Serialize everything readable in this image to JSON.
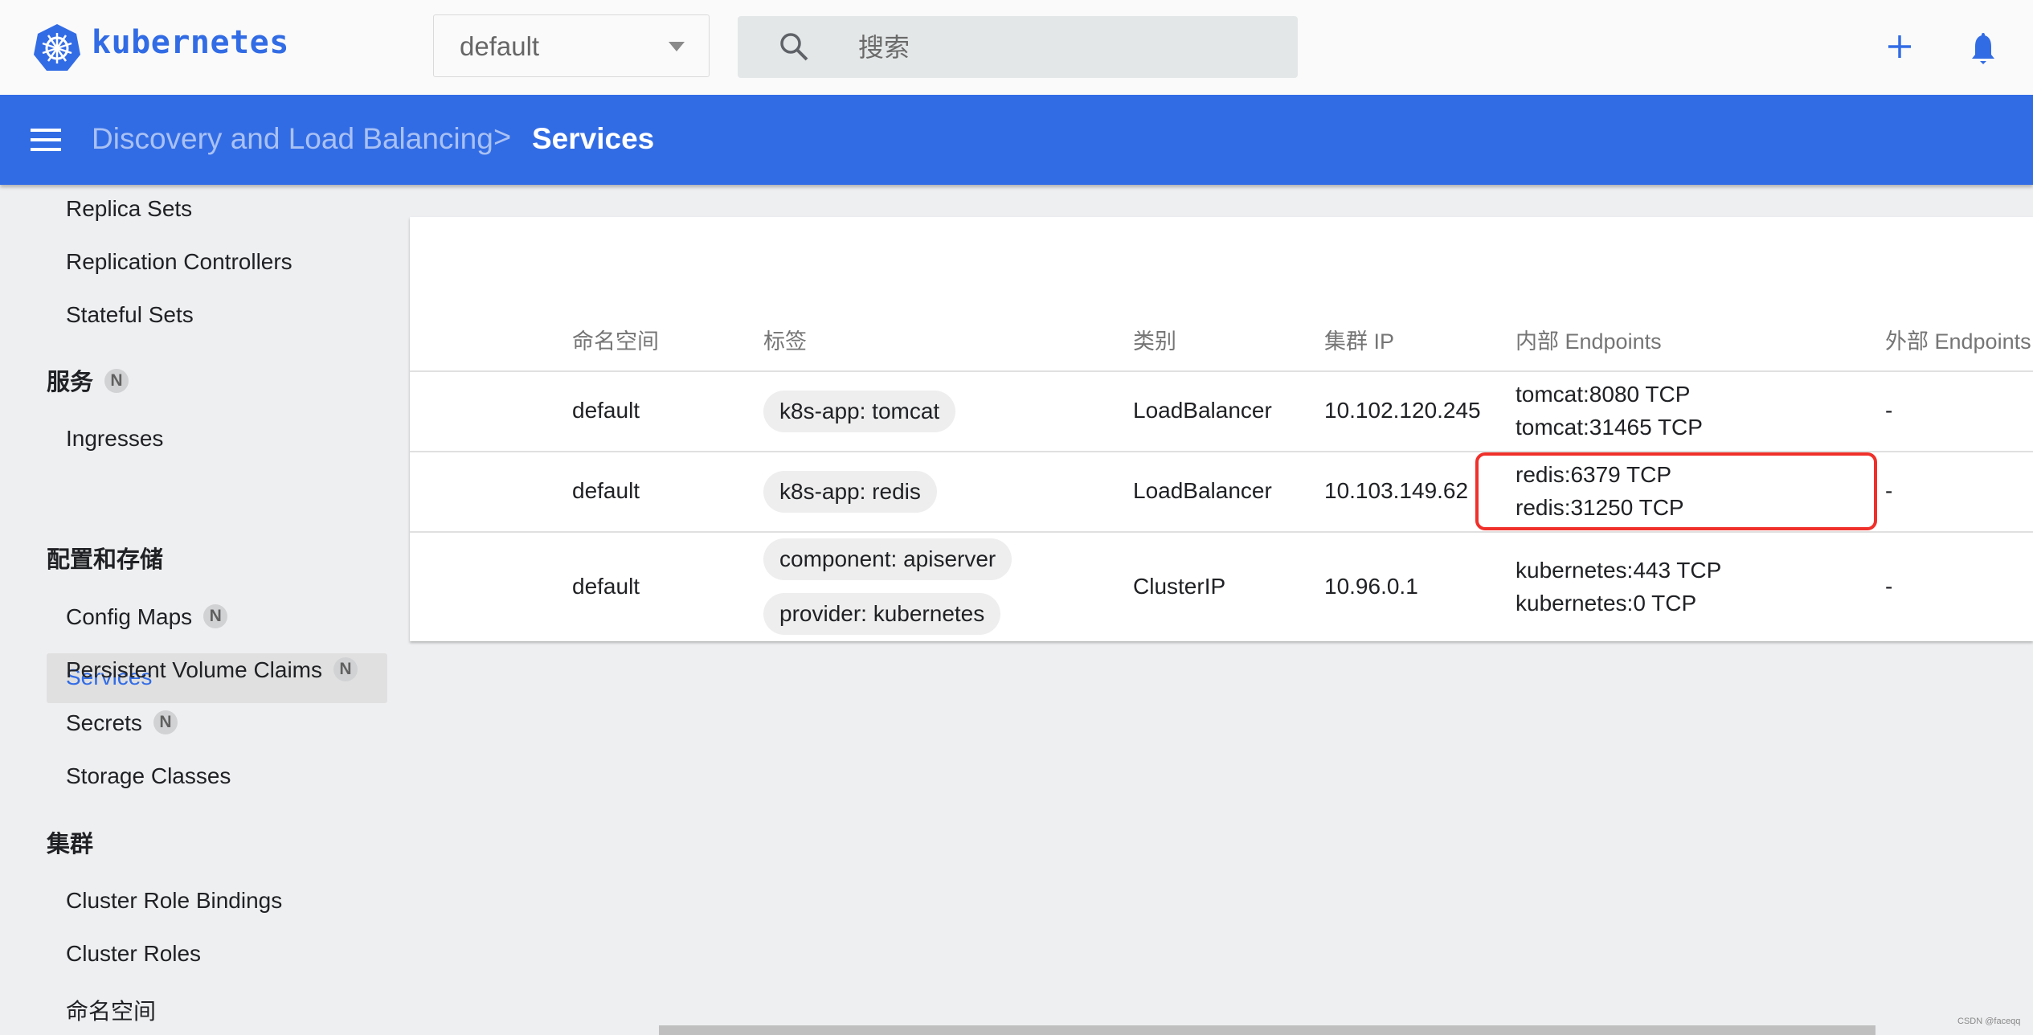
{
  "header": {
    "brand": "kubernetes",
    "namespace_select": {
      "value": "default"
    },
    "search": {
      "placeholder": "搜索",
      "value": ""
    },
    "icons": {
      "logo": "kubernetes-wheel-icon",
      "search": "search-icon",
      "create": "plus-icon",
      "notifications": "bell-icon",
      "dropdown": "caret-down-icon"
    },
    "accent_color": "#326ce5"
  },
  "breadcrumb": {
    "menu_icon": "hamburger-menu-icon",
    "parent": "Discovery and Load Balancing",
    "separator": ">",
    "current": "Services"
  },
  "sidebar": {
    "items": [
      {
        "type": "item",
        "label": "Replica Sets"
      },
      {
        "type": "item",
        "label": "Replication Controllers"
      },
      {
        "type": "item",
        "label": "Stateful Sets"
      },
      {
        "type": "section",
        "label": "服务",
        "badge": "N"
      },
      {
        "type": "item",
        "label": "Ingresses"
      },
      {
        "type": "item",
        "label": "Services",
        "active": true
      },
      {
        "type": "section",
        "label": "配置和存储"
      },
      {
        "type": "item",
        "label": "Config Maps",
        "badge": "N"
      },
      {
        "type": "item",
        "label": "Persistent Volume Claims",
        "badge": "N"
      },
      {
        "type": "item",
        "label": "Secrets",
        "badge": "N"
      },
      {
        "type": "item",
        "label": "Storage Classes"
      },
      {
        "type": "section",
        "label": "集群"
      },
      {
        "type": "item",
        "label": "Cluster Role Bindings"
      },
      {
        "type": "item",
        "label": "Cluster Roles"
      },
      {
        "type": "item",
        "label": "命名空间"
      }
    ]
  },
  "table": {
    "columns": [
      "命名空间",
      "标签",
      "类别",
      "集群 IP",
      "内部 Endpoints",
      "外部 Endpoints"
    ],
    "rows": [
      {
        "namespace": "default",
        "labels": [
          "k8s-app: tomcat"
        ],
        "type": "LoadBalancer",
        "cluster_ip": "10.102.120.245",
        "internal_endpoints": [
          "tomcat:8080 TCP",
          "tomcat:31465 TCP"
        ],
        "external_endpoints": "-"
      },
      {
        "namespace": "default",
        "labels": [
          "k8s-app: redis"
        ],
        "type": "LoadBalancer",
        "cluster_ip": "10.103.149.62",
        "internal_endpoints": [
          "redis:6379 TCP",
          "redis:31250 TCP"
        ],
        "external_endpoints": "-",
        "highlighted": true
      },
      {
        "namespace": "default",
        "labels": [
          "component: apiserver",
          "provider: kubernetes"
        ],
        "type": "ClusterIP",
        "cluster_ip": "10.96.0.1",
        "internal_endpoints": [
          "kubernetes:443 TCP",
          "kubernetes:0 TCP"
        ],
        "external_endpoints": "-"
      }
    ],
    "highlight_color": "#f0302a"
  },
  "watermark": "CSDN @faceqq"
}
